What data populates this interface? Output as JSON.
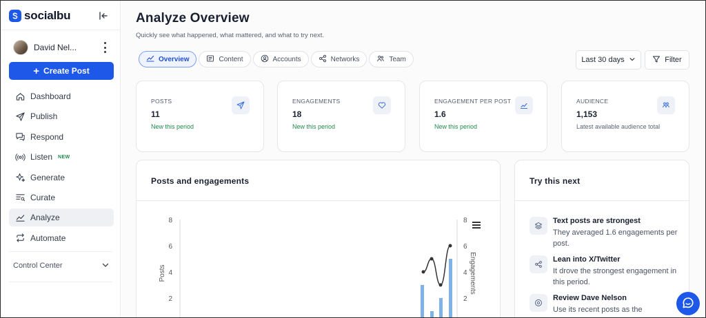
{
  "brand": {
    "name": "socialbu"
  },
  "user": {
    "name": "David Nel..."
  },
  "sidebar": {
    "create_label": "Create Post",
    "items": [
      {
        "label": "Dashboard",
        "icon": "home-icon"
      },
      {
        "label": "Publish",
        "icon": "send-icon"
      },
      {
        "label": "Respond",
        "icon": "chat-icon"
      },
      {
        "label": "Listen",
        "icon": "broadcast-icon",
        "badge": "NEW"
      },
      {
        "label": "Generate",
        "icon": "sparkle-icon"
      },
      {
        "label": "Curate",
        "icon": "curate-icon"
      },
      {
        "label": "Analyze",
        "icon": "analytics-icon",
        "active": true
      },
      {
        "label": "Automate",
        "icon": "repeat-icon"
      }
    ],
    "control_center": "Control Center"
  },
  "header": {
    "title": "Analyze Overview",
    "subtitle": "Quickly see what happened, what mattered, and what to try next."
  },
  "tabs": [
    {
      "label": "Overview",
      "active": true
    },
    {
      "label": "Content"
    },
    {
      "label": "Accounts"
    },
    {
      "label": "Networks"
    },
    {
      "label": "Team"
    }
  ],
  "controls": {
    "range": "Last 30 days",
    "filter": "Filter"
  },
  "stats": [
    {
      "label": "POSTS",
      "value": "11",
      "note": "New this period",
      "icon": "send-icon"
    },
    {
      "label": "ENGAGEMENTS",
      "value": "18",
      "note": "New this period",
      "icon": "heart-icon"
    },
    {
      "label": "ENGAGEMENT PER POST",
      "value": "1.6",
      "note": "New this period",
      "icon": "trend-icon"
    },
    {
      "label": "AUDIENCE",
      "value": "1,153",
      "note": "Latest available audience total",
      "icon": "audience-icon"
    }
  ],
  "chart_panel": {
    "title": "Posts and engagements"
  },
  "chart_data": {
    "type": "bar",
    "title": "",
    "ylabel": "Posts",
    "y2label": "Engagements",
    "ylim": [
      0,
      8
    ],
    "y2lim": [
      0,
      8
    ],
    "yticks": [
      "8",
      "6",
      "4",
      "2"
    ],
    "y2ticks": [
      "8",
      "6",
      "4",
      "2"
    ],
    "bars": [
      3,
      1,
      2,
      5
    ],
    "line": [
      4,
      5,
      3,
      6
    ]
  },
  "try_next": {
    "title": "Try this next",
    "items": [
      {
        "title": "Text posts are strongest",
        "desc": "They averaged 1.6 engagements per post.",
        "icon": "layers-icon"
      },
      {
        "title": "Lean into X/Twitter",
        "desc": "It drove the strongest engagement in this period.",
        "icon": "share-icon"
      },
      {
        "title": "Review Dave Nelson",
        "desc": "Use its recent posts as the",
        "icon": "at-icon"
      }
    ]
  }
}
